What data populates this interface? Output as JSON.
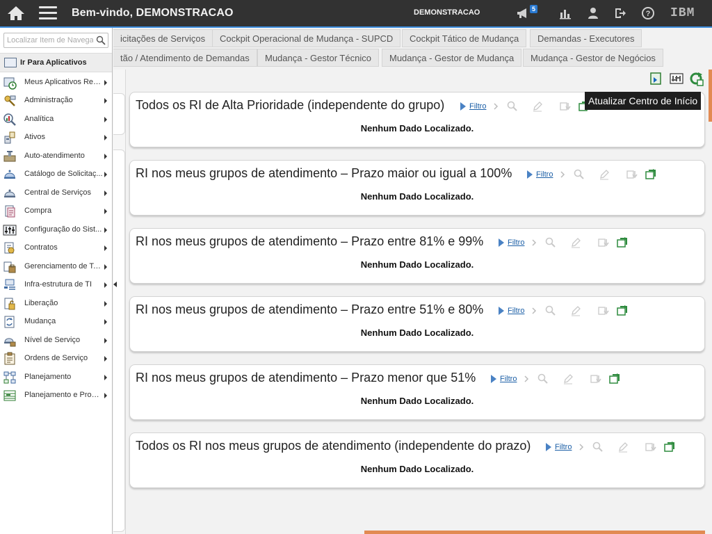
{
  "topbar": {
    "welcome": "Bem-vindo, DEMONSTRACAO",
    "user": "DEMONSTRACAO",
    "badge_count": "5",
    "brand": "IBM"
  },
  "tabs": {
    "row1": [
      "icitações de Serviços",
      "Cockpit Operacional de Mudança - SUPCD",
      "Cockpit Tático de Mudança",
      "Demandas - Executores"
    ],
    "row2": [
      "tão / Atendimento de Demandas",
      "Mudança - Gestor Técnico",
      "Mudança - Gestor de Mudança",
      "Mudança - Gestor de Negócios"
    ]
  },
  "tooltip": "Atualizar Centro de Início",
  "sidebar": {
    "search_placeholder": "Localizar Item de Navegação",
    "goto_label": "Ir Para Aplicativos",
    "items": [
      {
        "label": "Meus Aplicativos Rec...",
        "icon": "recent-apps-icon"
      },
      {
        "label": "Administração",
        "icon": "administration-icon"
      },
      {
        "label": "Analítica",
        "icon": "analytics-icon"
      },
      {
        "label": "Ativos",
        "icon": "assets-icon"
      },
      {
        "label": "Auto-atendimento",
        "icon": "self-service-icon"
      },
      {
        "label": "Catálogo de Solicitaç...",
        "icon": "service-catalog-icon"
      },
      {
        "label": "Central de Serviços",
        "icon": "service-desk-icon"
      },
      {
        "label": "Compra",
        "icon": "purchasing-icon"
      },
      {
        "label": "Configuração do Sist...",
        "icon": "system-config-icon"
      },
      {
        "label": "Contratos",
        "icon": "contracts-icon"
      },
      {
        "label": "Gerenciamento de Ta...",
        "icon": "task-management-icon"
      },
      {
        "label": "Infra-estrutura de TI",
        "icon": "it-infrastructure-icon"
      },
      {
        "label": "Liberação",
        "icon": "release-icon"
      },
      {
        "label": "Mudança",
        "icon": "change-icon"
      },
      {
        "label": "Nível de Serviço",
        "icon": "service-level-icon"
      },
      {
        "label": "Ordens de Serviço",
        "icon": "work-orders-icon"
      },
      {
        "label": "Planejamento",
        "icon": "planning-icon"
      },
      {
        "label": "Planejamento e Progr...",
        "icon": "planning-scheduling-icon"
      }
    ]
  },
  "portlets": [
    {
      "title": "Todos os RI de Alta Prioridade (independente do grupo)",
      "filter": "Filtro",
      "empty": "Nenhum Dado Localizado."
    },
    {
      "title": "RI nos meus grupos de atendimento – Prazo maior ou igual a 100%",
      "filter": "Filtro",
      "empty": "Nenhum Dado Localizado."
    },
    {
      "title": "RI nos meus grupos de atendimento – Prazo entre 81% e 99%",
      "filter": "Filtro",
      "empty": "Nenhum Dado Localizado."
    },
    {
      "title": "RI nos meus grupos de atendimento – Prazo entre 51% e 80%",
      "filter": "Filtro",
      "empty": "Nenhum Dado Localizado."
    },
    {
      "title": "RI nos meus grupos de atendimento – Prazo menor que 51%",
      "filter": "Filtro",
      "empty": "Nenhum Dado Localizado."
    },
    {
      "title": "Todos os RI nos meus grupos de atendimento (independente do prazo)",
      "filter": "Filtro",
      "empty": "Nenhum Dado Localizado."
    }
  ],
  "colors": {
    "topbar": "#323232",
    "accent": "#3c8dde",
    "scroll": "#e28a52"
  }
}
